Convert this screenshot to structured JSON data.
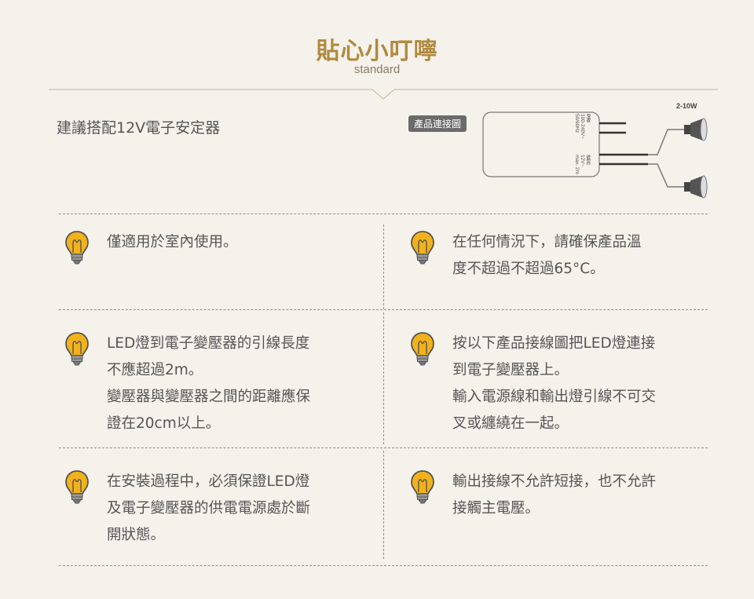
{
  "header": {
    "title": "貼心小叮嚀",
    "subtitle": "standard"
  },
  "recommend": "建議搭配12V電子安定器",
  "diagram": {
    "tag": "產品連接圖",
    "wattage": "2-10W",
    "pri_label": "PRI",
    "pri_spec_1": "100-240V~",
    "pri_spec_2": "50/60Hz",
    "sec_label": "SEC",
    "sec_spec_1": "12V~",
    "sec_spec_2": "max. 2m"
  },
  "tips": [
    {
      "lines": [
        "僅適用於室內使用。"
      ]
    },
    {
      "lines": [
        "在任何情況下，請確保產品溫",
        "度不超過不超過65°C。"
      ]
    },
    {
      "lines": [
        "LED燈到電子變壓器的引線長度",
        "不應超過2m。",
        "變壓器與變壓器之間的距離應保",
        "證在20cm以上。"
      ]
    },
    {
      "lines": [
        "按以下產品接線圖把LED燈連接",
        "到電子變壓器上。",
        "輸入電源線和輸出燈引線不可交",
        "叉或纏繞在一起。"
      ]
    },
    {
      "lines": [
        "在安裝過程中，必須保證LED燈",
        "及電子變壓器的供電電源處於斷",
        "開狀態。"
      ]
    },
    {
      "lines": [
        "輸出接線不允許短接，也不允許",
        "接觸主電壓。"
      ]
    }
  ],
  "colors": {
    "accent": "#b08a3e",
    "background": "#f5f2ec",
    "bulb": "#f2b21b"
  }
}
